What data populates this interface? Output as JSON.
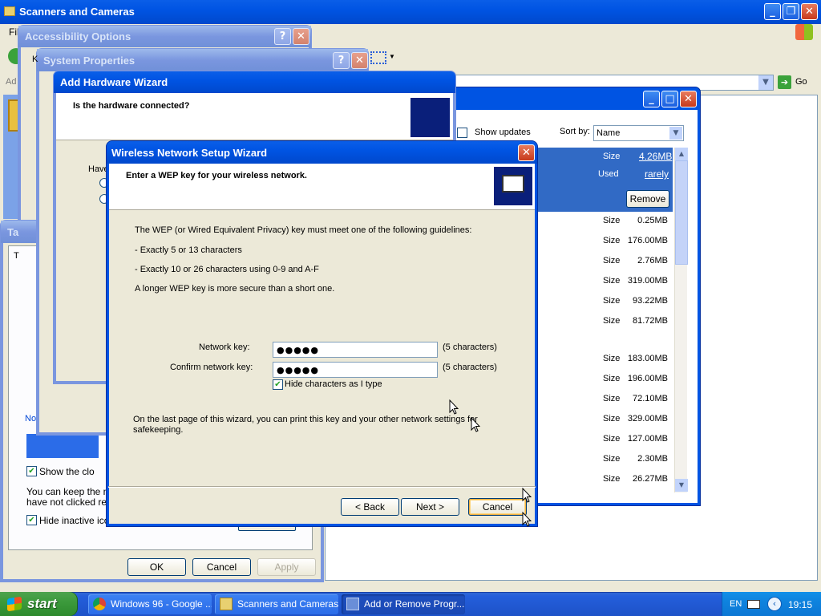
{
  "scanners_window": {
    "title": "Scanners and Cameras",
    "menu_file": "Fil",
    "address_prefix": "Ad",
    "go_label": "Go"
  },
  "accessibility": {
    "title": "Accessibility Options"
  },
  "system_properties": {
    "title": "System Properties",
    "tab_fragment": "K"
  },
  "taskbar_props": {
    "title_fragment": "Ta",
    "tab_fragment": "T",
    "group_fragment": "No",
    "show_clock": "Show the clo",
    "desc_line1": "You can keep the no",
    "desc_line2": "have not clicked rece",
    "hide_inactive": "Hide inactive icon",
    "ok": "OK",
    "cancel": "Cancel",
    "apply": "Apply"
  },
  "add_hardware": {
    "title": "Add Hardware Wizard",
    "heading": "Is the hardware connected?",
    "have_fragment": "Have"
  },
  "add_remove": {
    "show_updates": "Show updates",
    "sort_by_label": "Sort by:",
    "sort_value": "Name",
    "size_label": "Size",
    "size_value": "4.26MB",
    "used_label": "Used",
    "used_value": "rarely",
    "remove_button": "Remove",
    "sizes": [
      "0.25MB",
      "176.00MB",
      "2.76MB",
      "319.00MB",
      "93.22MB",
      "81.72MB",
      "183.00MB",
      "196.00MB",
      "72.10MB",
      "329.00MB",
      "127.00MB",
      "2.30MB",
      "26.27MB"
    ]
  },
  "wireless": {
    "title": "Wireless Network Setup Wizard",
    "heading": "Enter a WEP key for your wireless network.",
    "intro": "The WEP (or Wired Equivalent Privacy) key must meet one of the following guidelines:",
    "rule1": "- Exactly 5 or 13 characters",
    "rule2": "- Exactly 10 or 26 characters using 0-9 and A-F",
    "note": "A longer WEP key is more secure than a short one.",
    "network_key_label": "Network key:",
    "network_key_value": "●●●●●",
    "network_key_count": "(5 characters)",
    "confirm_key_label": "Confirm network key:",
    "confirm_key_value": "●●●●●",
    "confirm_key_count": "(5 characters)",
    "hide_chars_label": "Hide characters as I type",
    "footer_line1": "On the last page of this wizard, you can print this key and your other network settings for",
    "footer_line2": "safekeeping.",
    "back_button": "< Back",
    "next_button": "Next >",
    "cancel_button": "Cancel"
  },
  "taskbar": {
    "start": "start",
    "items": [
      "Windows 96 - Google ...",
      "Scanners and Cameras",
      "Add or Remove Progr..."
    ],
    "lang": "EN",
    "clock": "19:15"
  }
}
